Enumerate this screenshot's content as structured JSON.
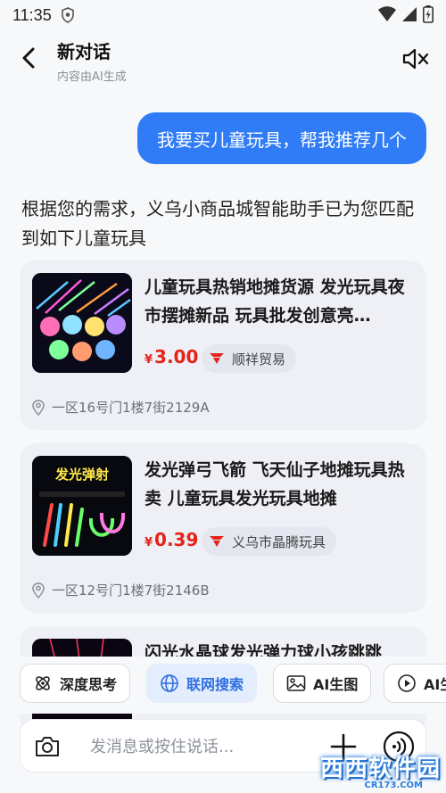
{
  "status_bar": {
    "time": "11:35"
  },
  "header": {
    "title": "新对话",
    "subtitle": "内容由AI生成"
  },
  "conversation": {
    "user_message": "我要买儿童玩具，帮我推荐几个",
    "assistant_message": "根据您的需求，义乌小商品城智能助手已为您匹配到如下儿童玩具"
  },
  "products": [
    {
      "title": "儿童玩具热销地摊货源 发光玩具夜市摆摊新品 玩具批发创意亮…",
      "price_symbol": "¥",
      "price": "3.00",
      "shop": "顺祥贸易",
      "location": "一区16号门1楼7街2129A"
    },
    {
      "title": "发光弹弓飞箭 飞天仙子地摊玩具热卖 儿童玩具发光玩具地摊",
      "price_symbol": "¥",
      "price": "0.39",
      "shop": "义乌市晶腾玩具",
      "location": "一区12号门1楼7街2146B",
      "thumb_text": "发光弹射"
    },
    {
      "title": "闪光水晶球发光弹力球小孩跳跳"
    }
  ],
  "chips": [
    {
      "label": "深度思考",
      "icon": "atom-icon",
      "active": false
    },
    {
      "label": "联网搜索",
      "icon": "globe-icon",
      "active": true
    },
    {
      "label": "AI生图",
      "icon": "image-icon",
      "active": false
    },
    {
      "label": "AI生",
      "icon": "video-ai-icon",
      "active": false
    }
  ],
  "input": {
    "placeholder": "发消息或按住说话..."
  },
  "watermark": {
    "text": "西西软件园",
    "sub": "CR173.COM"
  },
  "colors": {
    "accent": "#2f7cf6",
    "price": "#e5231b",
    "shop_icon": "#e5231b"
  }
}
